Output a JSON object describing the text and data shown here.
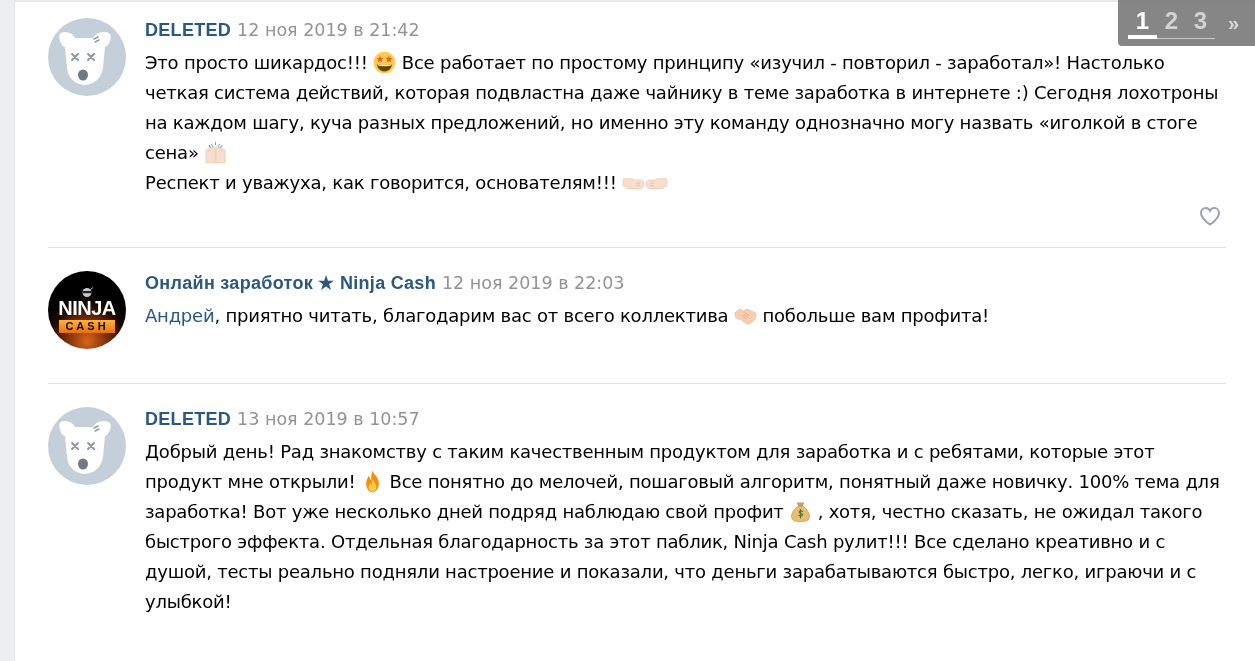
{
  "comments": [
    {
      "avatar": {
        "kind": "deleted"
      },
      "author": "DELETED",
      "date": "12 ноя 2019 в 21:42",
      "paragraphs": [
        [
          {
            "kind": "text",
            "text": "Это просто шикардос!!! "
          },
          {
            "kind": "starstruck"
          },
          {
            "kind": "text",
            "text": " Все работает по простому принципу «изучил - повторил - заработал»! Настолько четкая система действий, которая подвластна даже чайнику в теме заработка в интернете :) Сегодня лохотроны на каждом шагу, куча разных предложений, но именно эту команду однозначно могу назвать «иголкой в стоге сена» "
          },
          {
            "kind": "hands"
          }
        ],
        [
          {
            "kind": "text",
            "text": "Респект и уважуха, как говорится, основателям!!! "
          },
          {
            "kind": "fistright"
          },
          {
            "kind": "fistleft"
          }
        ]
      ],
      "like": {
        "liked": false
      }
    },
    {
      "avatar": {
        "kind": "logo",
        "lines": [
          "NINJA",
          "CASH"
        ]
      },
      "author": "Онлайн заработок ★ Ninja Cash",
      "date": "12 ноя 2019 в 22:03",
      "paragraphs": [
        [
          {
            "kind": "mention",
            "text": "Андрей"
          },
          {
            "kind": "text",
            "text": ", приятно читать, благодарим вас от всего коллектива "
          },
          {
            "kind": "handshake"
          },
          {
            "kind": "text",
            "text": " побольше вам профита!"
          }
        ]
      ]
    },
    {
      "avatar": {
        "kind": "deleted"
      },
      "author": "DELETED",
      "date": "13 ноя 2019 в 10:57",
      "paragraphs": [
        [
          {
            "kind": "text",
            "text": "Добрый день! Рад знакомству с таким качественным продуктом для заработка и с ребятами, которые этот продукт мне открыли! "
          },
          {
            "kind": "fire"
          },
          {
            "kind": "text",
            "text": " Все понятно до мелочей, пошаговый алгоритм, понятный даже новичку. 100% тема для заработка! Вот уже несколько дней подряд наблюдаю свой профит "
          },
          {
            "kind": "moneybag"
          },
          {
            "kind": "text",
            "text": " , хотя, честно сказать, не ожидал такого быстрого эффекта. Отдельная благодарность за этот паблик, Ninja Cash рулит!!! Все сделано креативно и с душой, тесты реально подняли настроение и показали, что деньги зарабатываются быстро, легко, играючи и с улыбкой!"
          }
        ]
      ]
    }
  ],
  "pager": {
    "pages": [
      {
        "label": "1",
        "selected": true
      },
      {
        "label": "2",
        "selected": false
      },
      {
        "label": "3",
        "selected": false
      }
    ],
    "next": "»"
  }
}
